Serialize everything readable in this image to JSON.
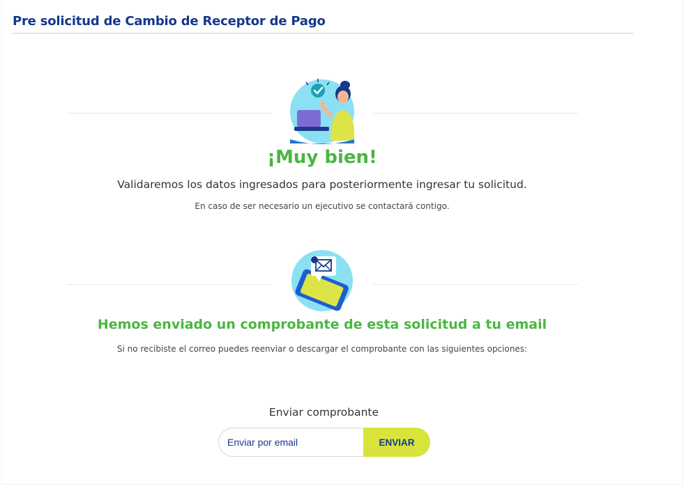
{
  "header": {
    "title": "Pre solicitud de Cambio de Receptor de Pago"
  },
  "success": {
    "illustration": "woman-with-laptop-checkmark",
    "heading": "¡Muy bien!",
    "message": "Validaremos los datos ingresados para posteriormente ingresar tu solicitud.",
    "note": "En caso de ser necesario un ejecutivo se contactará contigo."
  },
  "email_section": {
    "illustration": "phone-with-envelope",
    "heading": "Hemos enviado un comprobante de esta solicitud a tu email",
    "note": "Si no recibiste el correo puedes reenviar o descargar el comprobante con las siguientes opciones:"
  },
  "send_form": {
    "label": "Enviar comprobante",
    "placeholder": "Enviar por email",
    "button_label": "ENVIAR"
  },
  "colors": {
    "brand_blue": "#15388b",
    "success_green": "#4bb543",
    "button_yellow": "#d8e33b",
    "illustration_bg": "#8be0f4"
  }
}
